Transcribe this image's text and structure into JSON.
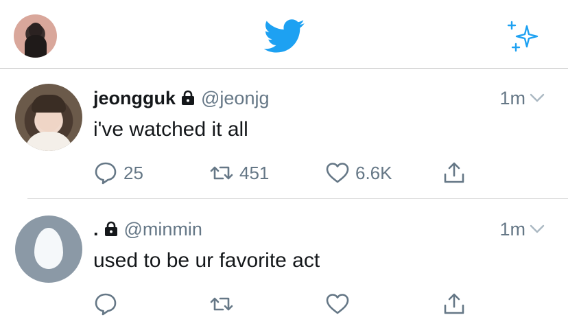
{
  "header": {
    "icons": [
      "profile-avatar",
      "twitter-bird-icon",
      "sparkle-icon"
    ]
  },
  "tweets": [
    {
      "name": "jeongguk",
      "handle": "@jeonjg",
      "time": "1m",
      "text": "i've watched it all",
      "replies": "25",
      "retweets": "451",
      "likes": "6.6K"
    },
    {
      "name": ".",
      "handle": "@minmin",
      "time": "1m",
      "text": "used to be ur favorite act",
      "replies": "",
      "retweets": "",
      "likes": ""
    }
  ],
  "colors": {
    "brand": "#1da1f2",
    "secondary_text": "#657786",
    "primary_text": "#14171a"
  }
}
